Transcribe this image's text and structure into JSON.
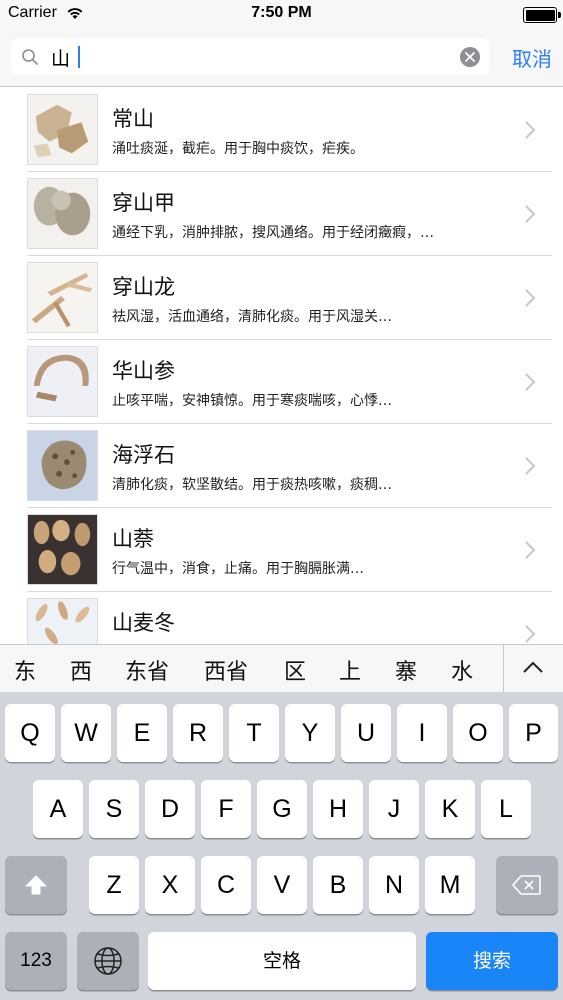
{
  "status_bar": {
    "carrier": "Carrier",
    "time": "7:50 PM",
    "battery_level": 1.0
  },
  "search": {
    "query": "山",
    "cancel_label": "取消"
  },
  "results": [
    {
      "title": "常山",
      "desc": "涌吐痰涎，截疟。用于胸中痰饮，疟疾。",
      "thumb_color": "#c9b393"
    },
    {
      "title": "穿山甲",
      "desc": "通经下乳，消肿排脓，搜风通络。用于经闭癥瘕，…",
      "thumb_color": "#b8b0a0"
    },
    {
      "title": "穿山龙",
      "desc": "祛风湿，活血通络，清肺化痰。用于风湿关…",
      "thumb_color": "#caa882"
    },
    {
      "title": "华山参",
      "desc": "止咳平喘，安神镇惊。用于寒痰喘咳，心悸…",
      "thumb_color": "#b7987a"
    },
    {
      "title": "海浮石",
      "desc": "清肺化痰，软坚散结。用于痰热咳嗽，痰稠…",
      "thumb_color": "#9a8a72"
    },
    {
      "title": "山萘",
      "desc": "行气温中，消食，止痛。用于胸膈胀满…",
      "thumb_color": "#c9a47a"
    },
    {
      "title": "山麦冬",
      "desc": "",
      "thumb_color": "#d9b893"
    }
  ],
  "candidates": [
    "东",
    "西",
    "东省",
    "西省",
    "区",
    "上",
    "寨",
    "水"
  ],
  "keyboard": {
    "row1": [
      "Q",
      "W",
      "E",
      "R",
      "T",
      "Y",
      "U",
      "I",
      "O",
      "P"
    ],
    "row2": [
      "A",
      "S",
      "D",
      "F",
      "G",
      "H",
      "J",
      "K",
      "L"
    ],
    "row3": [
      "Z",
      "X",
      "C",
      "V",
      "B",
      "N",
      "M"
    ],
    "numbers_key": "123",
    "space_key": "空格",
    "search_key": "搜索"
  },
  "colors": {
    "accent": "#2f7cf6",
    "search_key": "#1a84f9",
    "keyboard_bg": "#d1d4da"
  }
}
